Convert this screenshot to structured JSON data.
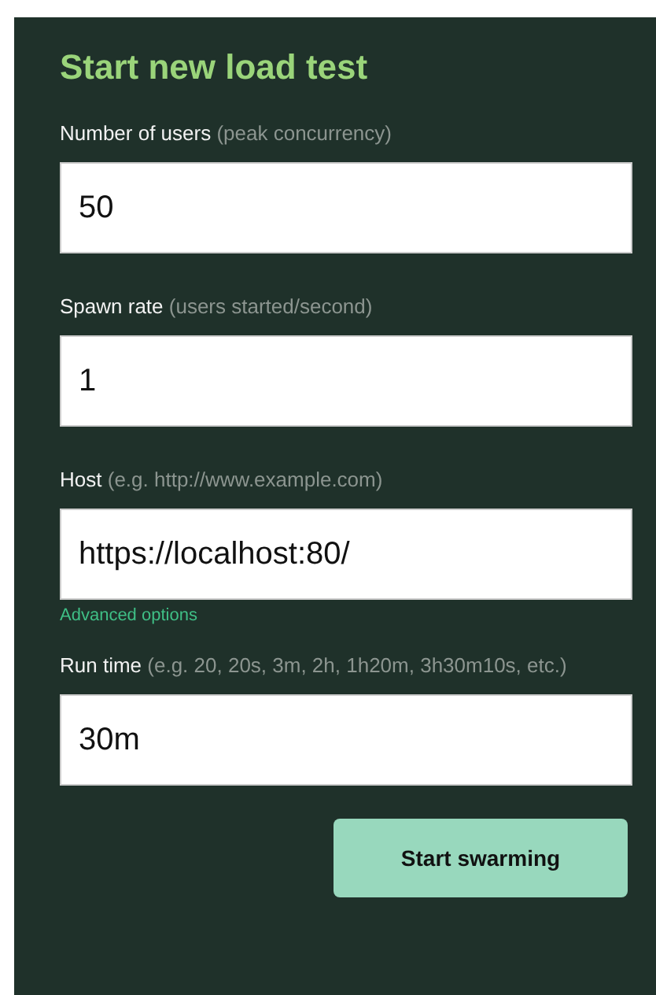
{
  "title": "Start new load test",
  "fields": [
    {
      "label": "Number of users",
      "hint": "(peak concurrency)",
      "value": "50"
    },
    {
      "label": "Spawn rate",
      "hint": "(users started/second)",
      "value": "1"
    },
    {
      "label": "Host",
      "hint": "(e.g. http://www.example.com)",
      "value": "https://localhost:80/",
      "link": "Advanced options"
    },
    {
      "label": "Run time",
      "hint": "(e.g. 20, 20s, 3m, 2h, 1h20m, 3h30m10s, etc.)",
      "value": "30m"
    }
  ],
  "submit": "Start swarming"
}
